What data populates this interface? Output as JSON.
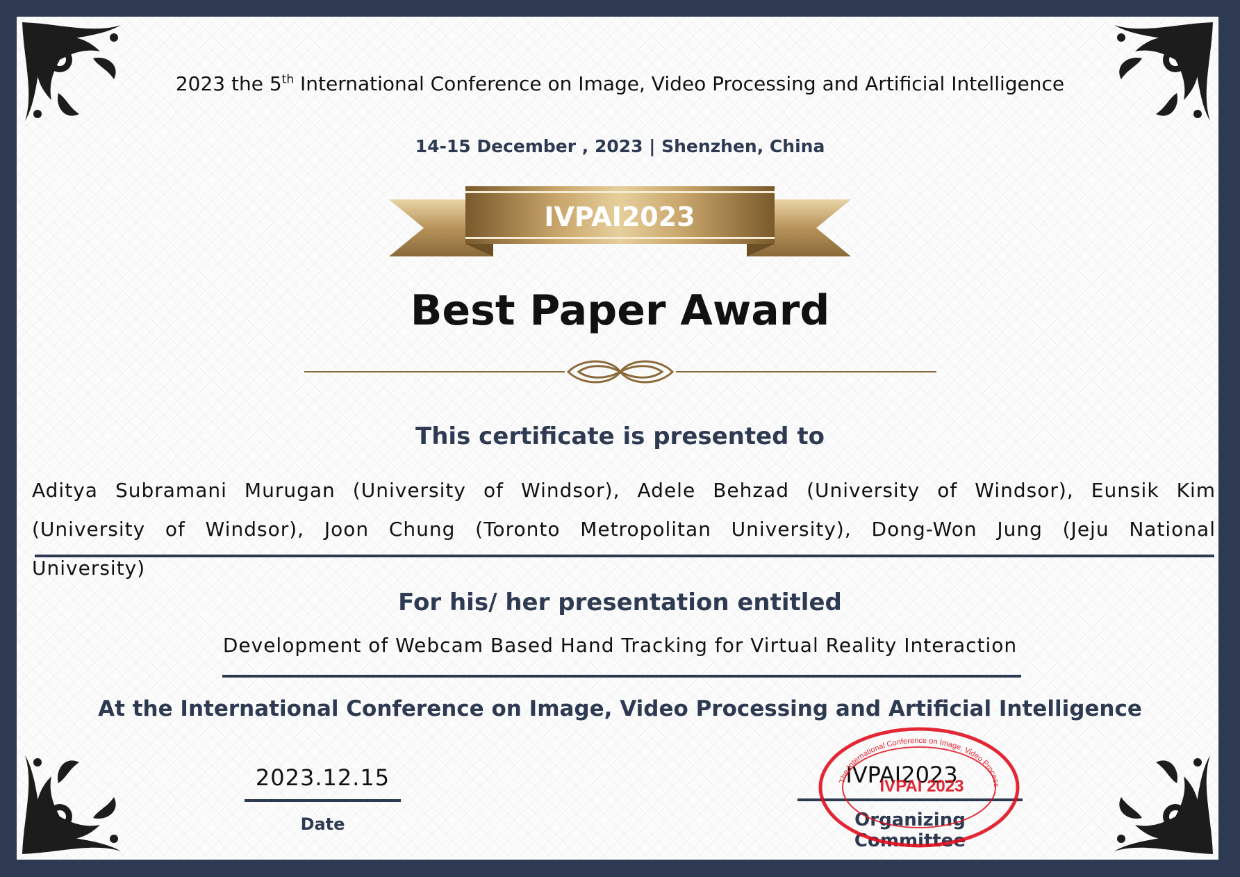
{
  "conference": {
    "title_pre": "2023 the 5",
    "title_sup": "th",
    "title_post": " International Conference on Image, Video Processing and Artificial Intelligence",
    "dates": "14-15 December , 2023 | Shenzhen, China"
  },
  "ribbon_label": "IVPAI2023",
  "award_title": "Best Paper Award",
  "presented_label": "This certificate is presented to",
  "recipients": "Aditya Subramani Murugan (University of Windsor), Adele Behzad (University of Windsor), Eunsik Kim (University of Windsor), Joon Chung (Toronto Metropolitan University), Dong-Won Jung (Jeju National University)",
  "presentation_label": "For his/ her presentation entitled",
  "paper_title": "Development of Webcam Based Hand Tracking for Virtual Reality Interaction",
  "at_label": "At the International Conference on Image, Video Processing and Artificial Intelligence",
  "date": {
    "value": "2023.12.15",
    "label": "Date"
  },
  "organizer": {
    "value": "IVPAI2023",
    "label": "Organizing Committee"
  },
  "seal": {
    "ring_text": "The International Conference on Image, Video Processing and Artificial Intelligence",
    "center_text": "IVPAI 2023"
  },
  "colors": {
    "frame": "#2e3a52",
    "gold": "#b08a4e",
    "seal_red": "#e0101e",
    "navy_text": "#2e3a52"
  }
}
